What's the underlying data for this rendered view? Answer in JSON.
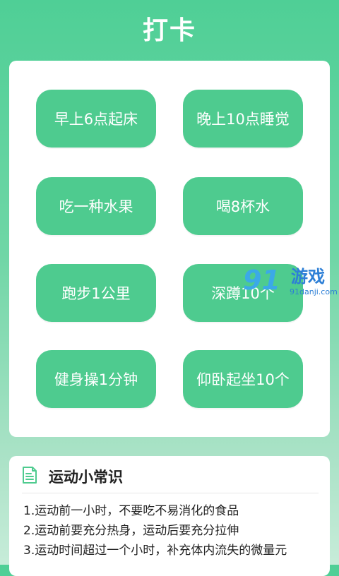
{
  "header": {
    "title": "打卡"
  },
  "checkins": [
    {
      "label": "早上6点起床"
    },
    {
      "label": "晚上10点睡觉"
    },
    {
      "label": "吃一种水果"
    },
    {
      "label": "喝8杯水"
    },
    {
      "label": "跑步1公里"
    },
    {
      "label": "深蹲10个"
    },
    {
      "label": "健身操1分钟"
    },
    {
      "label": "仰卧起坐10个"
    }
  ],
  "watermark": {
    "logo": "91",
    "name": "游戏",
    "url": "91danji.com"
  },
  "tips": {
    "title": "运动小常识",
    "icon": "document-icon",
    "items": [
      "1.运动前一小时，不要吃不易消化的食品",
      "2.运动前要充分热身，运动后要充分拉伸",
      "3.运动时间超过一个小时，补充体内流失的微量元"
    ]
  },
  "colors": {
    "accent": "#4ecb8f",
    "background_top": "#4fcf96",
    "card": "#ffffff"
  }
}
